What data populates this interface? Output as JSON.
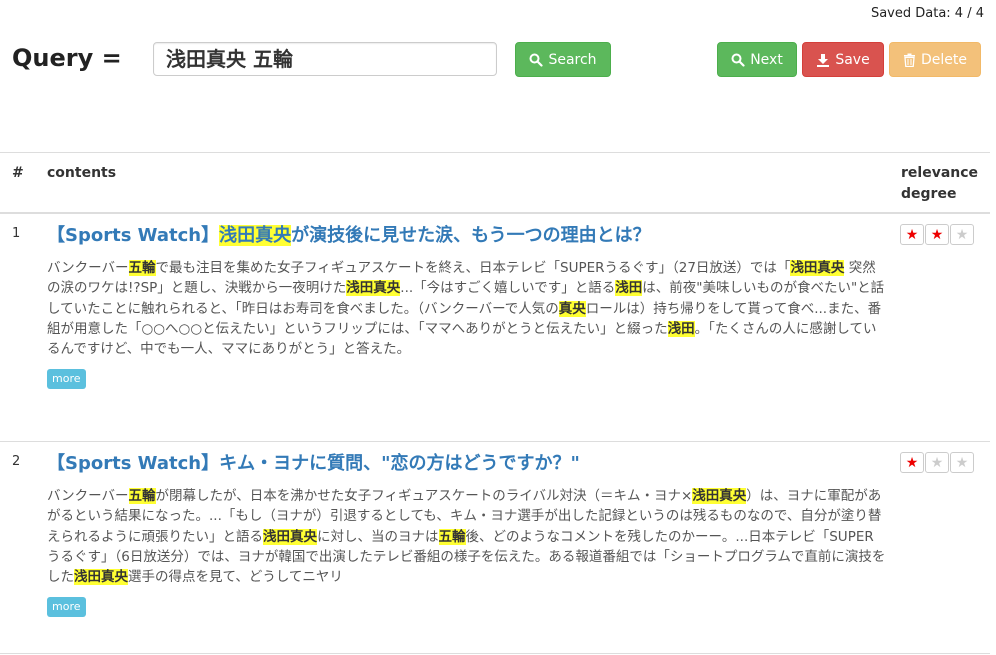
{
  "saved_data": "Saved Data: 4 / 4",
  "query": {
    "label": "Query =",
    "value": "浅田真央 五輪",
    "search_label": "Search",
    "next_label": "Next",
    "save_label": "Save",
    "delete_label": "Delete"
  },
  "table": {
    "col_num": "#",
    "col_contents": "contents",
    "col_relevance_line1": "relevance",
    "col_relevance_line2": "degree"
  },
  "rows": [
    {
      "num": "1",
      "title_segments": [
        {
          "t": "【Sports Watch】",
          "h": false
        },
        {
          "t": "浅田真央",
          "h": true
        },
        {
          "t": "が演技後に見せた涙、もう一つの理由とは？",
          "h": false
        }
      ],
      "snippet_segments": [
        {
          "t": "バンクーバー",
          "h": false
        },
        {
          "t": "五輪",
          "h": true
        },
        {
          "t": "で最も注目を集めた女子フィギュアスケートを終え、日本テレビ「SUPERうるぐす」（27日放送）では「",
          "h": false
        },
        {
          "t": "浅田真央",
          "h": true
        },
        {
          "t": " 突然の涙のワケは!?SP」と題し、決戦から一夜明けた",
          "h": false
        },
        {
          "t": "浅田真央",
          "h": true
        },
        {
          "t": "...「今はすごく嬉しいです」と語る",
          "h": false
        },
        {
          "t": "浅田",
          "h": true
        },
        {
          "t": "は、前夜\"美味しいものが食べたい\"と話していたことに触れられると、「昨日はお寿司を食べました。（バンクーバーで人気の",
          "h": false
        },
        {
          "t": "真央",
          "h": true
        },
        {
          "t": "ロールは）持ち帰りをして貰って食べ...また、番組が用意した「○○へ○○と伝えたい」というフリップには、「ママへありがとうと伝えたい」と綴った",
          "h": false
        },
        {
          "t": "浅田",
          "h": true
        },
        {
          "t": "。「たくさんの人に感謝しているんですけど、中でも一人、ママにありがとう」と答えた。",
          "h": false
        }
      ],
      "more_label": "more",
      "stars": 2,
      "max_stars": 3
    },
    {
      "num": "2",
      "title_segments": [
        {
          "t": "【Sports Watch】キム・ヨナに質問、\"恋の方はどうですか？\"",
          "h": false
        }
      ],
      "snippet_segments": [
        {
          "t": "バンクーバー",
          "h": false
        },
        {
          "t": "五輪",
          "h": true
        },
        {
          "t": "が閉幕したが、日本を沸かせた女子フィギュアスケートのライバル対決（＝キム・ヨナ×",
          "h": false
        },
        {
          "t": "浅田真央",
          "h": true
        },
        {
          "t": "）は、ヨナに軍配があがるという結果になった。...「もし（ヨナが）引退するとしても、キム・ヨナ選手が出した記録というのは残るものなので、自分が塗り替えられるように頑張りたい」と語る",
          "h": false
        },
        {
          "t": "浅田真央",
          "h": true
        },
        {
          "t": "に対し、当のヨナは",
          "h": false
        },
        {
          "t": "五輪",
          "h": true
        },
        {
          "t": "後、どのようなコメントを残したのかーー。...日本テレビ「SUPERうるぐす」（6日放送分）では、ヨナが韓国で出演したテレビ番組の様子を伝えた。ある報道番組では「ショートプログラムで直前に演技をした",
          "h": false
        },
        {
          "t": "浅田真央",
          "h": true
        },
        {
          "t": "選手の得点を見て、どうしてニヤリ",
          "h": false
        }
      ],
      "more_label": "more",
      "stars": 1,
      "max_stars": 3
    }
  ]
}
